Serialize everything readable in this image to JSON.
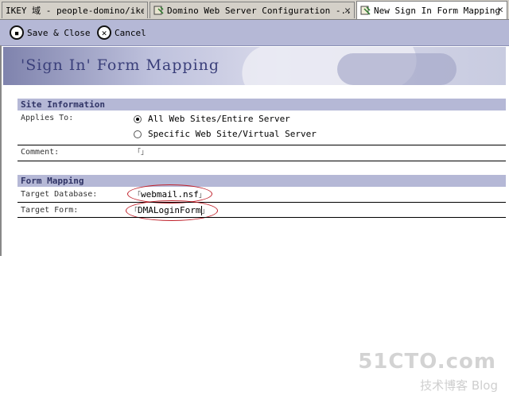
{
  "tabs": [
    {
      "label": "IKEY 域 - people-domino/ikey",
      "active": false
    },
    {
      "label": "Domino Web Server Configuration -...",
      "active": false,
      "close": "✕"
    },
    {
      "label": "New Sign In Form Mapping",
      "active": true,
      "close": "✕"
    }
  ],
  "actions": {
    "save": {
      "label": "Save & Close",
      "icon": "save-icon"
    },
    "cancel": {
      "label": "Cancel",
      "icon": "cancel-icon"
    }
  },
  "banner": {
    "title": "'Sign In' Form Mapping"
  },
  "site_info": {
    "heading": "Site Information",
    "applies_to_label": "Applies To:",
    "options": [
      {
        "label": "All Web Sites/Entire Server",
        "selected": true
      },
      {
        "label": "Specific Web Site/Virtual Server",
        "selected": false
      }
    ],
    "comment_label": "Comment:",
    "comment_value": ""
  },
  "form_mapping": {
    "heading": "Form Mapping",
    "target_db_label": "Target Database:",
    "target_db_value": "webmail.nsf",
    "target_form_label": "Target Form:",
    "target_form_value": "DMALoginForm"
  },
  "watermark": {
    "main": "51CTO.com",
    "sub": "技术博客  Blog"
  },
  "colors": {
    "accent": "#b5b8d6",
    "annotation": "#c0202a",
    "heading_text": "#303466"
  }
}
